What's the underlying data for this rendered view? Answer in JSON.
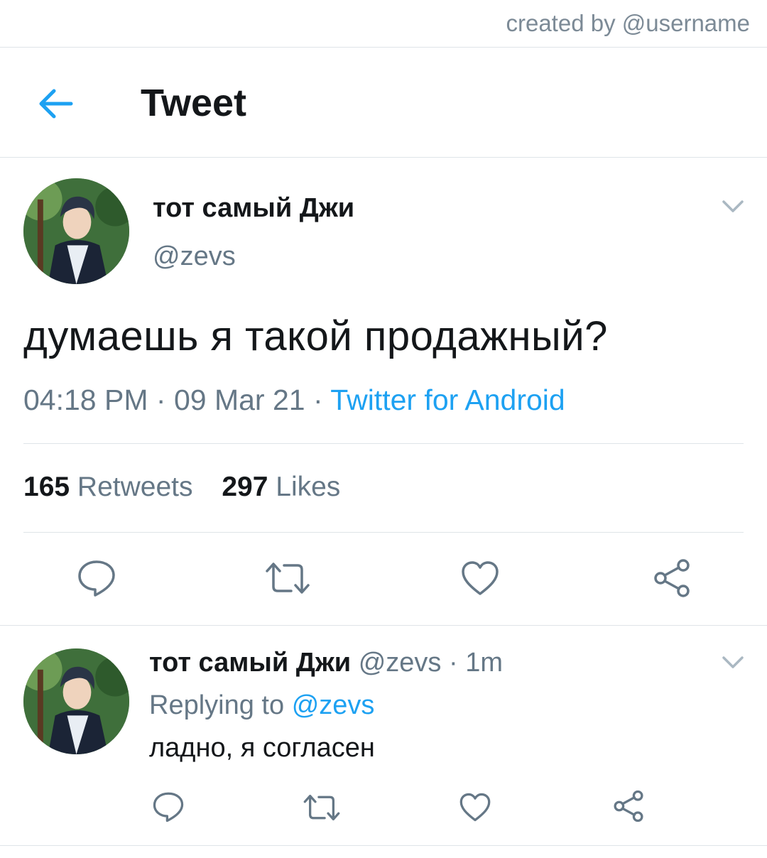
{
  "credit": "created by @username",
  "header": {
    "title": "Tweet"
  },
  "tweet": {
    "author_name": "тот самый Джи",
    "author_handle": "@zevs",
    "text": "думаешь я такой продажный?",
    "time": "04:18 PM",
    "date": "09 Mar 21",
    "source": "Twitter for Android",
    "separator": "·",
    "retweets_count": "165",
    "retweets_label": "Retweets",
    "likes_count": "297",
    "likes_label": "Likes"
  },
  "reply": {
    "author_name": "тот самый Джи",
    "author_handle": "@zevs",
    "age": "· 1m",
    "replying_to_label": "Replying to",
    "replying_to_handle": "@zevs",
    "text": "ладно, я согласен"
  },
  "icons": {
    "back": "arrow-left-icon",
    "menu": "chevron-down-icon",
    "actions": [
      "reply-icon",
      "retweet-icon",
      "like-icon",
      "share-icon"
    ]
  },
  "colors": {
    "accent": "#1da1f2",
    "muted": "#657786",
    "text": "#14171a",
    "divider": "#dfe4e8"
  }
}
